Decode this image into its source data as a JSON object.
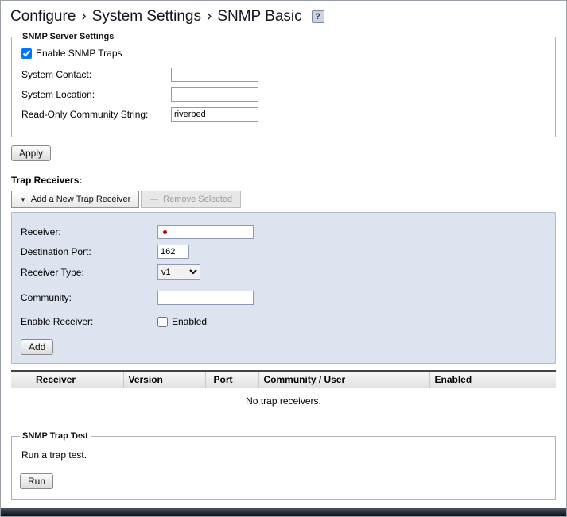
{
  "page": {
    "title_parts": [
      "Configure",
      "System Settings",
      "SNMP Basic"
    ],
    "separator": "›",
    "help_label": "?"
  },
  "icons": {
    "triangle_down": "▼",
    "minus": "—"
  },
  "colors": {
    "panel_bg": "#dde4ef",
    "required_marker": "#b30000",
    "footer_bar": "#0c0e13"
  },
  "snmp_server_settings": {
    "legend": "SNMP Server Settings",
    "enable_traps": {
      "label": "Enable SNMP Traps",
      "checked": true
    },
    "fields": [
      {
        "label": "System Contact:",
        "value": ""
      },
      {
        "label": "System Location:",
        "value": ""
      },
      {
        "label": "Read-Only Community String:",
        "value": "riverbed"
      }
    ],
    "apply_label": "Apply"
  },
  "trap_receivers": {
    "heading": "Trap Receivers:",
    "add_button": "Add a New Trap Receiver",
    "remove_button": "Remove Selected",
    "form": {
      "receiver_label": "Receiver:",
      "receiver_value": "",
      "destination_port_label": "Destination Port:",
      "destination_port_value": "162",
      "receiver_type_label": "Receiver Type:",
      "receiver_type_value": "v1",
      "community_label": "Community:",
      "community_value": "",
      "enable_receiver_label": "Enable Receiver:",
      "enabled_checkbox_label": "Enabled",
      "enabled_checked": false,
      "add_label": "Add"
    },
    "table": {
      "columns": [
        "Receiver",
        "Version",
        "Port",
        "Community / User",
        "Enabled"
      ],
      "empty_text": "No trap receivers."
    }
  },
  "snmp_trap_test": {
    "legend": "SNMP Trap Test",
    "description": "Run a trap test.",
    "run_label": "Run"
  }
}
